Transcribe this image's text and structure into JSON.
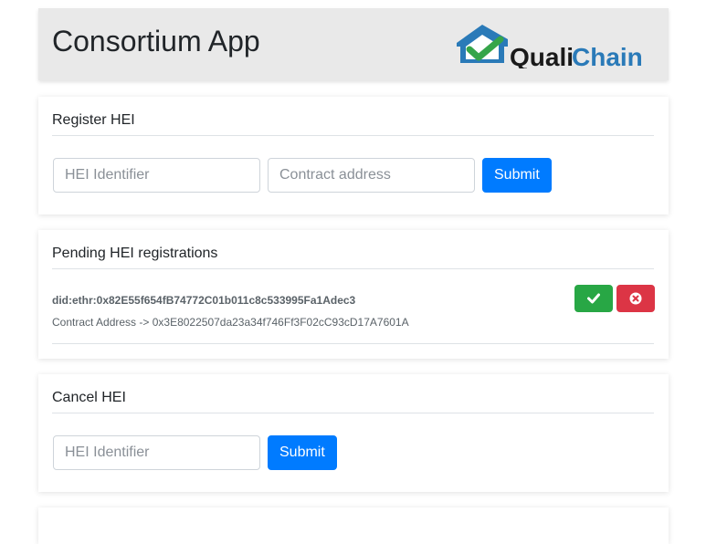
{
  "header": {
    "title": "Consortium App",
    "logo_text_1": "Quali",
    "logo_text_2": "Chain",
    "logo_colors": {
      "house": "#2a7ab8",
      "check": "#36a54a",
      "text": "#1a1a1a",
      "chain": "#2a7ab8"
    }
  },
  "register": {
    "title": "Register HEI",
    "hei_placeholder": "HEI Identifier",
    "contract_placeholder": "Contract address",
    "submit_label": "Submit"
  },
  "pending": {
    "title": "Pending HEI registrations",
    "items": [
      {
        "did": "did:ethr:0x82E55f654fB74772C01b011c8c533995Fa1Adec3",
        "contract": "Contract Address -> 0x3E8022507da23a34f746Ff3F02cC93cD17A7601A",
        "accept_icon": "check-icon",
        "reject_icon": "times-circle-icon"
      }
    ]
  },
  "cancel": {
    "title": "Cancel HEI",
    "hei_placeholder": "HEI Identifier",
    "submit_label": "Submit"
  },
  "colors": {
    "primary": "#007bff",
    "success": "#28a745",
    "danger": "#dc3545",
    "header_bg": "#e9e9e9"
  }
}
